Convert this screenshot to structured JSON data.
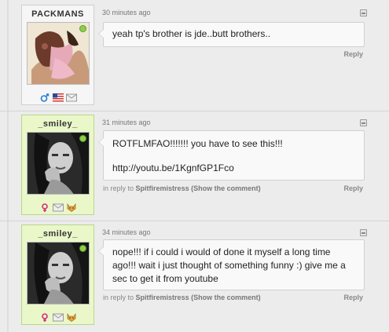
{
  "comments": [
    {
      "username": "PACKMANS",
      "timestamp": "30 minutes ago",
      "text": [
        "yeah tp's brother is jde..butt brothers.."
      ],
      "reply_label": "Reply",
      "icons": [
        "male-gender-icon",
        "us-flag-icon",
        "message-icon"
      ],
      "online": true,
      "accent": "#f6f6f6"
    },
    {
      "username": "_smiley_",
      "timestamp": "31 minutes ago",
      "text": [
        "ROTFLMFAO!!!!!!! you have to see this!!!",
        "http://youtu.be/1KgnfGP1Fco"
      ],
      "in_reply_prefix": "in reply to",
      "in_reply_user": "Spitfiremistress",
      "show_comment": "(Show the comment)",
      "reply_label": "Reply",
      "icons": [
        "female-gender-icon",
        "message-icon",
        "cat-icon"
      ],
      "online": true,
      "accent": "#eaf7c9"
    },
    {
      "username": "_smiley_",
      "timestamp": "34 minutes ago",
      "text": [
        "nope!!! if i could i would of done it myself a long time ago!!! wait i just thought of something funny :) give me a sec to get it from youtube"
      ],
      "in_reply_prefix": "in reply to",
      "in_reply_user": "Spitfiremistress",
      "show_comment": "(Show the comment)",
      "reply_label": "Reply",
      "icons": [
        "female-gender-icon",
        "message-icon",
        "cat-icon"
      ],
      "online": true,
      "accent": "#eaf7c9"
    }
  ]
}
